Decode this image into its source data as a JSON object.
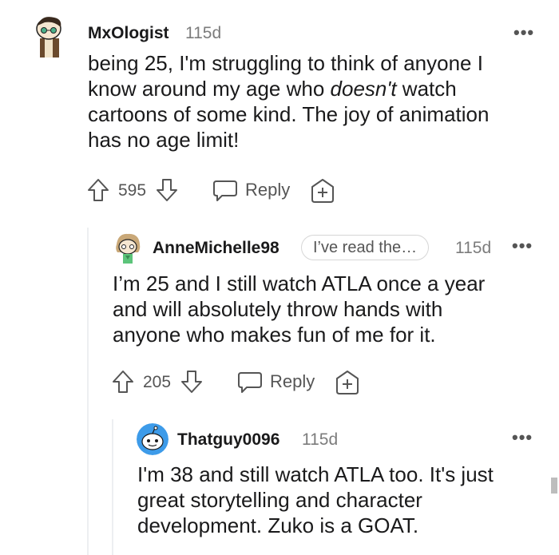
{
  "comments": [
    {
      "username": "MxOlogist",
      "time": "115d",
      "avatar_icon": "snoo-avatar-icon",
      "body_lines": [
        "being 25, I'm struggling to think of anyone I",
        "know around my age who",
        "doesn't",
        " watch",
        "cartoons of some kind. The joy of animation",
        "has no age limit!"
      ],
      "votes": "595",
      "reply_label": "Reply"
    },
    {
      "username": "AnneMichelle98",
      "flair": "I’ve read the…",
      "time": "115d",
      "avatar_icon": "snoo-avatar-icon",
      "body_lines": [
        "I’m 25 and I still watch ATLA once a year",
        "and will absolutely throw hands with",
        "anyone who makes fun of me for it."
      ],
      "votes": "205",
      "reply_label": "Reply"
    },
    {
      "username": "Thatguy0096",
      "time": "115d",
      "avatar_icon": "snoo-avatar-icon",
      "body_lines": [
        "I'm 38 and still watch ATLA too. It's just",
        "great storytelling and character",
        "development. Zuko is a GOAT."
      ]
    }
  ],
  "more_label": "•••",
  "colors": {
    "text": "#1a1a1b",
    "meta": "#7c7c7c",
    "icon": "#555555",
    "line": "#edeff1"
  }
}
